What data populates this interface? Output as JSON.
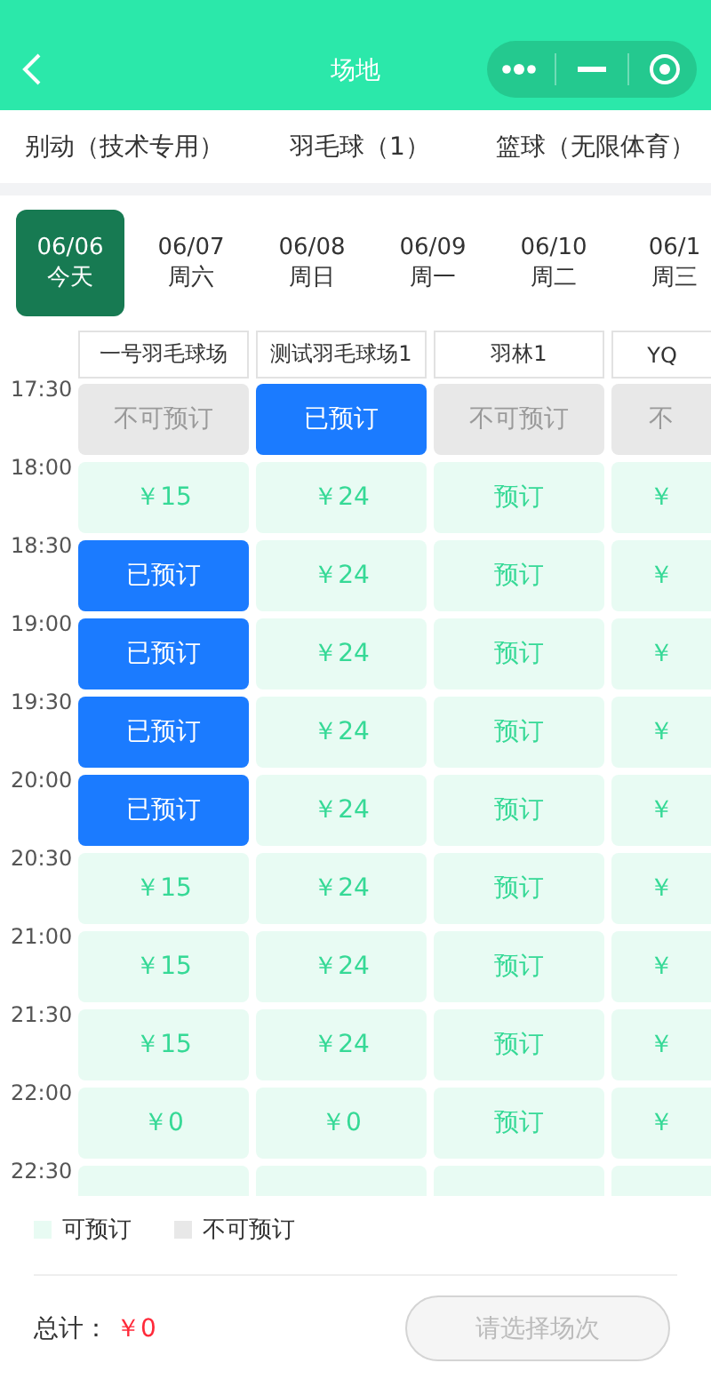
{
  "nav": {
    "title": "场地"
  },
  "categories": [
    {
      "label": "别动（技术专用）"
    },
    {
      "label": "羽毛球（1）"
    },
    {
      "label": "篮球（无限体育）"
    }
  ],
  "dates": [
    {
      "date": "06/06",
      "day": "今天",
      "selected": true
    },
    {
      "date": "06/07",
      "day": "周六",
      "selected": false
    },
    {
      "date": "06/08",
      "day": "周日",
      "selected": false
    },
    {
      "date": "06/09",
      "day": "周一",
      "selected": false
    },
    {
      "date": "06/10",
      "day": "周二",
      "selected": false
    },
    {
      "date": "06/1",
      "day": "周三",
      "selected": false
    }
  ],
  "courts": [
    "一号羽毛球场",
    "测试羽毛球场1",
    "羽林1",
    "YQ"
  ],
  "rows": [
    {
      "time": "17:30",
      "cells": [
        {
          "kind": "unavailable",
          "text": "不可预订"
        },
        {
          "kind": "booked",
          "text": "已预订"
        },
        {
          "kind": "unavailable",
          "text": "不可预订"
        },
        {
          "kind": "unavailable",
          "text": "不"
        }
      ]
    },
    {
      "time": "18:00",
      "cells": [
        {
          "kind": "open",
          "text": "￥15"
        },
        {
          "kind": "open",
          "text": "￥24"
        },
        {
          "kind": "open",
          "text": "预订"
        },
        {
          "kind": "open",
          "text": "￥"
        }
      ]
    },
    {
      "time": "18:30",
      "cells": [
        {
          "kind": "booked",
          "text": "已预订"
        },
        {
          "kind": "open",
          "text": "￥24"
        },
        {
          "kind": "open",
          "text": "预订"
        },
        {
          "kind": "open",
          "text": "￥"
        }
      ]
    },
    {
      "time": "19:00",
      "cells": [
        {
          "kind": "booked",
          "text": "已预订"
        },
        {
          "kind": "open",
          "text": "￥24"
        },
        {
          "kind": "open",
          "text": "预订"
        },
        {
          "kind": "open",
          "text": "￥"
        }
      ]
    },
    {
      "time": "19:30",
      "cells": [
        {
          "kind": "booked",
          "text": "已预订"
        },
        {
          "kind": "open",
          "text": "￥24"
        },
        {
          "kind": "open",
          "text": "预订"
        },
        {
          "kind": "open",
          "text": "￥"
        }
      ]
    },
    {
      "time": "20:00",
      "cells": [
        {
          "kind": "booked",
          "text": "已预订"
        },
        {
          "kind": "open",
          "text": "￥24"
        },
        {
          "kind": "open",
          "text": "预订"
        },
        {
          "kind": "open",
          "text": "￥"
        }
      ]
    },
    {
      "time": "20:30",
      "cells": [
        {
          "kind": "open",
          "text": "￥15"
        },
        {
          "kind": "open",
          "text": "￥24"
        },
        {
          "kind": "open",
          "text": "预订"
        },
        {
          "kind": "open",
          "text": "￥"
        }
      ]
    },
    {
      "time": "21:00",
      "cells": [
        {
          "kind": "open",
          "text": "￥15"
        },
        {
          "kind": "open",
          "text": "￥24"
        },
        {
          "kind": "open",
          "text": "预订"
        },
        {
          "kind": "open",
          "text": "￥"
        }
      ]
    },
    {
      "time": "21:30",
      "cells": [
        {
          "kind": "open",
          "text": "￥15"
        },
        {
          "kind": "open",
          "text": "￥24"
        },
        {
          "kind": "open",
          "text": "预订"
        },
        {
          "kind": "open",
          "text": "￥"
        }
      ]
    },
    {
      "time": "22:00",
      "cells": [
        {
          "kind": "open",
          "text": "￥0"
        },
        {
          "kind": "open",
          "text": "￥0"
        },
        {
          "kind": "open",
          "text": "预订"
        },
        {
          "kind": "open",
          "text": "￥"
        }
      ]
    },
    {
      "time": "22:30",
      "cells": [
        {
          "kind": "open"
        },
        {
          "kind": "open"
        },
        {
          "kind": "open"
        },
        {
          "kind": "open"
        }
      ]
    }
  ],
  "legend": [
    {
      "kind": "open",
      "label": "可预订"
    },
    {
      "kind": "unavailable",
      "label": "不可预订"
    }
  ],
  "footer": {
    "label": "总计：",
    "total": "￥0",
    "button": "请选择场次",
    "disabled": true
  }
}
